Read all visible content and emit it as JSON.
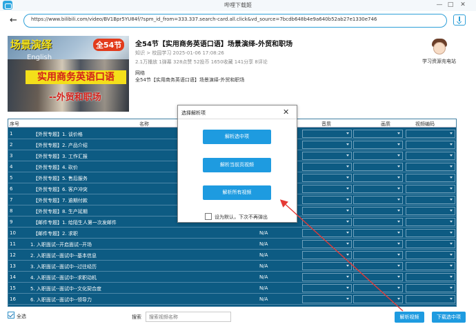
{
  "window": {
    "title": "哔哩下载姬"
  },
  "url": {
    "value": "https://www.bilibili.com/video/BV1Bpr5YU84f/?spm_id_from=333.337.search-card.all.click&vd_source=7bcdb648b4e9a640b52ab27e1330e746"
  },
  "video": {
    "title": "全54节【实用商务英语口语】场景演绎-外贸和职场",
    "meta1": "知识 > 校园学习   2025-01-06 17:08:26",
    "meta2": "2.1万播放   1弹幕   328点赞   52投币   1650收藏   141分享   8评论",
    "part_label": "网络",
    "part_title": "全54节【实用商务英语口语】场景演绎-外贸和职场",
    "cover": {
      "tag1": "场景演绎",
      "tag2": "全54节",
      "tag3": "English",
      "banner": "实用商务英语口语",
      "sub": "--外贸和职场"
    }
  },
  "uploader": {
    "name": "学习资源充电站"
  },
  "table": {
    "headers": {
      "index": "序号",
      "name": "名称",
      "audio": "音质",
      "video": "画质",
      "codec": "视频编码"
    },
    "rows": [
      {
        "idx": "1",
        "name": "【外贸专题】1. 谈价格",
        "size": ""
      },
      {
        "idx": "2",
        "name": "【外贸专题】2. 产品介绍",
        "size": ""
      },
      {
        "idx": "3",
        "name": "【外贸专题】3. 工作汇报",
        "size": ""
      },
      {
        "idx": "4",
        "name": "【外贸专题】4. 砍价",
        "size": ""
      },
      {
        "idx": "5",
        "name": "【外贸专题】5. 售后服务",
        "size": ""
      },
      {
        "idx": "6",
        "name": "【外贸专题】6. 客户冲突",
        "size": ""
      },
      {
        "idx": "7",
        "name": "【外贸专题】7. 逾期付款",
        "size": ""
      },
      {
        "idx": "8",
        "name": "【外贸专题】8. 生产延期",
        "size": ""
      },
      {
        "idx": "9",
        "name": "【邮件专题】1. 给陌生人第一次发邮件",
        "size": ""
      },
      {
        "idx": "10",
        "name": "【邮件专题】2. 求职",
        "size": "N/A"
      },
      {
        "idx": "11",
        "name": "1. 入职面试--开启面试--开场",
        "size": "N/A"
      },
      {
        "idx": "12",
        "name": "2. 入职面试--面试中--基本信息",
        "size": "N/A"
      },
      {
        "idx": "13",
        "name": "3. 入职面试--面试中--过往经历",
        "size": "N/A"
      },
      {
        "idx": "14",
        "name": "4. 入职面试--面试中--求职动机",
        "size": "N/A"
      },
      {
        "idx": "15",
        "name": "5. 入职面试--面试中--文化契合度",
        "size": "N/A"
      },
      {
        "idx": "16",
        "name": "6. 入职面试--面试中--领导力",
        "size": "N/A"
      }
    ]
  },
  "footer": {
    "select_all": "全选",
    "search_label": "搜索",
    "search_placeholder": "搜索视频名称",
    "parse_button": "解析视频",
    "download_button": "下载选中项"
  },
  "dialog": {
    "title": "选择解析项",
    "close": "✕",
    "options": [
      "解析选中项",
      "解析当前页视频",
      "解析所有视频"
    ],
    "remember": "设为默认，下次不再弹出"
  },
  "colors": {
    "accent": "#1e9be0",
    "table_bg": "#0d5b83",
    "arrow": "#e53935"
  }
}
